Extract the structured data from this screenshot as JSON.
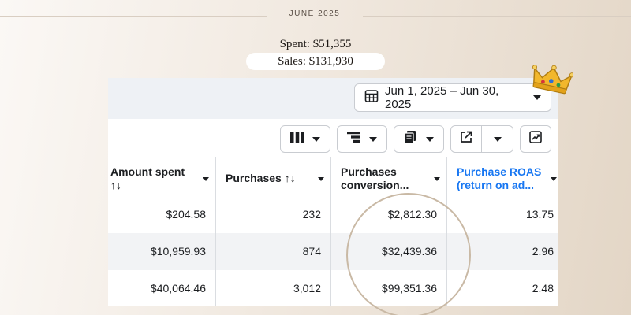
{
  "banner": {
    "month": "JUNE 2025",
    "spent": "Spent: $51,355",
    "sales": "Sales: $131,930"
  },
  "date_range": {
    "label": "Jun 1, 2025 – Jun 30, 2025",
    "icon": "calendar-table-icon"
  },
  "toolbar": {
    "columns_icon": "columns-icon",
    "breakdown_icon": "breakdown-icon",
    "reports_icon": "reports-icon",
    "export_icon": "export-icon",
    "chart_icon": "trend-chart-icon"
  },
  "table": {
    "columns": [
      {
        "line1": "Amount spent",
        "line2": "↑↓"
      },
      {
        "line1": "Purchases ↑↓",
        "line2": ""
      },
      {
        "line1": "Purchases",
        "line2": "conversion..."
      },
      {
        "line1": "Purchase ROAS",
        "line2": "(return on ad..."
      }
    ],
    "rows": [
      {
        "amount_spent": "$204.58",
        "purchases": "232",
        "conversion_value": "$2,812.30",
        "roas": "13.75"
      },
      {
        "amount_spent": "$10,959.93",
        "purchases": "874",
        "conversion_value": "$32,439.36",
        "roas": "2.96"
      },
      {
        "amount_spent": "$40,064.46",
        "purchases": "3,012",
        "conversion_value": "$99,351.36",
        "roas": "2.48"
      }
    ]
  },
  "colors": {
    "accent_blue": "#1877f2",
    "highlight_circle": "#c9b9a5",
    "crown_gold": "#f2b72c"
  }
}
